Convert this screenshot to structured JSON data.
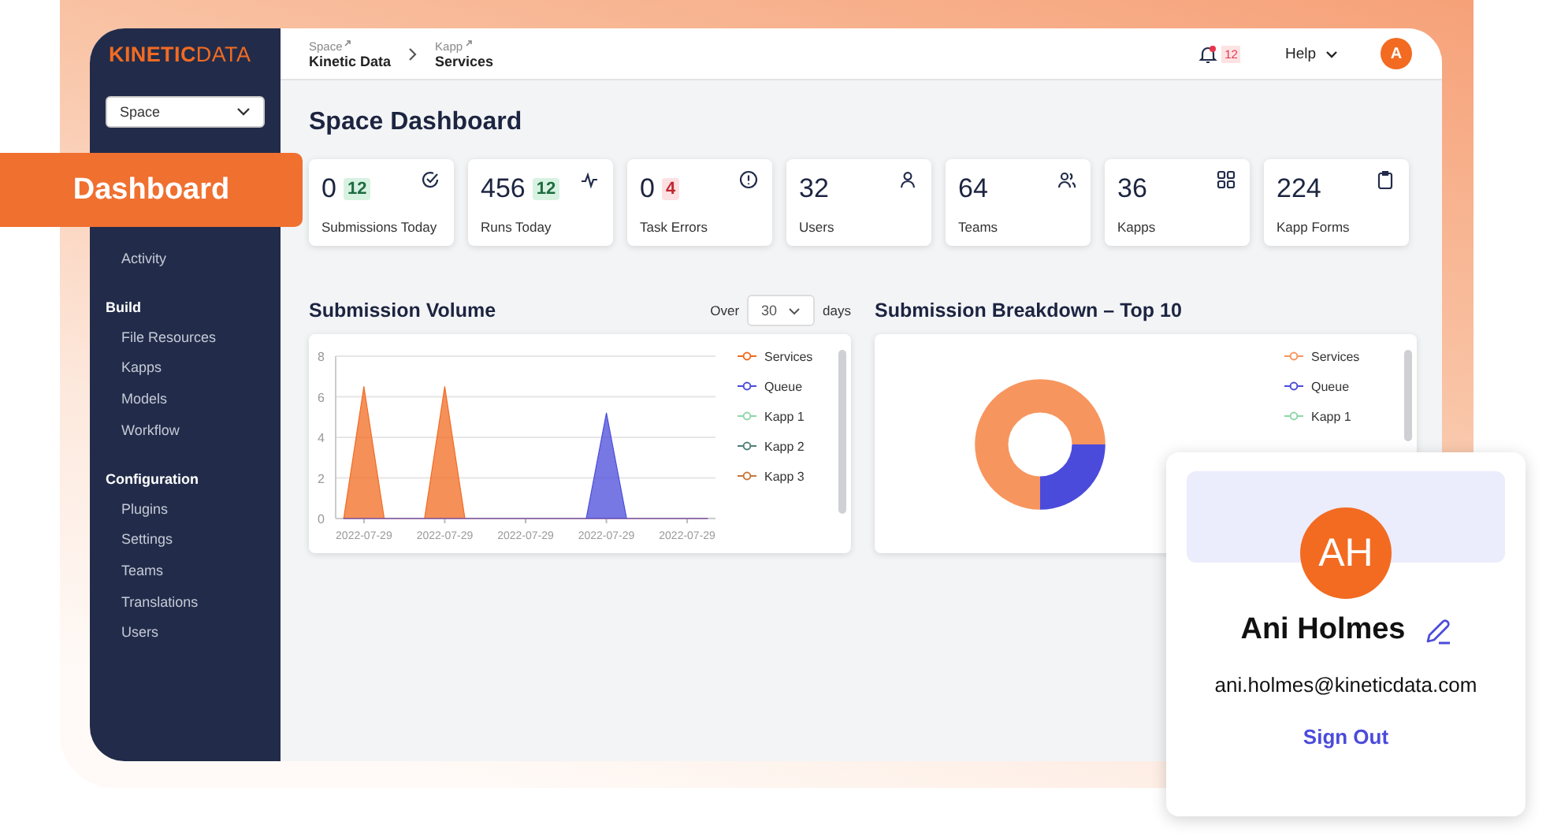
{
  "sidebar": {
    "logo": {
      "bold": "KINETIC",
      "light": "DATA"
    },
    "space_select": {
      "value": "Space"
    },
    "groups": [
      {
        "items": [
          "Activity"
        ]
      },
      {
        "heading": "Build",
        "items": [
          "File Resources",
          "Kapps",
          "Models",
          "Workflow"
        ]
      },
      {
        "heading": "Configuration",
        "items": [
          "Plugins",
          "Settings",
          "Teams",
          "Translations",
          "Users"
        ]
      }
    ]
  },
  "callout": {
    "label": "Dashboard"
  },
  "header": {
    "breadcrumbs": [
      {
        "label": "Space",
        "value": "Kinetic Data"
      },
      {
        "label": "Kapp",
        "value": "Services"
      }
    ],
    "notifications": "12",
    "help": "Help",
    "avatar": "A"
  },
  "page_title": "Space Dashboard",
  "stats": [
    {
      "value": "0",
      "badge": "12",
      "alert": false,
      "label": "Submissions Today"
    },
    {
      "value": "456",
      "badge": "12",
      "alert": false,
      "label": "Runs Today"
    },
    {
      "value": "0",
      "badge": "4",
      "alert": true,
      "label": "Task Errors"
    },
    {
      "value": "32",
      "label": "Users"
    },
    {
      "value": "64",
      "label": "Teams"
    },
    {
      "value": "36",
      "label": "Kapps"
    },
    {
      "value": "224",
      "label": "Kapp Forms"
    }
  ],
  "volume": {
    "title": "Submission Volume",
    "range": {
      "prefix": "Over",
      "value": "30",
      "suffix": "days"
    },
    "chart_data": {
      "type": "area",
      "grid": true,
      "legend": "right",
      "categories": [
        null,
        "2022-07-29",
        null,
        null,
        null,
        "2022-07-29",
        null,
        null,
        null,
        "2022-07-29",
        null,
        null,
        null,
        "2022-07-29",
        null,
        null,
        null,
        "2022-07-29",
        null
      ],
      "ylim": [
        0,
        8
      ],
      "yticks": [
        0,
        2,
        4,
        6,
        8
      ],
      "series": [
        {
          "name": "Services",
          "color": "#f26b21",
          "values": [
            0,
            6.5,
            0,
            0,
            0,
            6.5,
            0,
            0,
            0,
            0,
            0,
            0,
            0,
            0,
            0,
            0,
            0,
            0,
            0
          ]
        },
        {
          "name": "Queue",
          "color": "#4b4bdb",
          "values": [
            0,
            0,
            0,
            0,
            0,
            0,
            0,
            0,
            0,
            0,
            0,
            0,
            0,
            5.2,
            0,
            0,
            0,
            0,
            0
          ]
        },
        {
          "name": "Kapp 1",
          "color": "#8fd6a8",
          "values": [
            null,
            null,
            null,
            null,
            null,
            null,
            null,
            null,
            null,
            null,
            null,
            null,
            null,
            null,
            null,
            null,
            null,
            null,
            null
          ]
        },
        {
          "name": "Kapp 2",
          "color": "#4f7f77",
          "values": [
            null,
            null,
            null,
            null,
            null,
            null,
            null,
            null,
            null,
            null,
            null,
            null,
            null,
            null,
            null,
            null,
            null,
            null,
            null
          ]
        },
        {
          "name": "Kapp 3",
          "color": "#c8773a",
          "values": [
            null,
            null,
            null,
            null,
            null,
            null,
            null,
            null,
            null,
            null,
            null,
            null,
            null,
            null,
            null,
            null,
            null,
            null,
            null
          ]
        }
      ]
    }
  },
  "breakdown": {
    "title": "Submission Breakdown – Top 10",
    "legend": [
      {
        "label": "Services",
        "color": "#f7955e"
      },
      {
        "label": "Queue",
        "color": "#4b4bdb"
      },
      {
        "label": "Kapp 1",
        "color": "#8fd6a8"
      }
    ]
  },
  "profile": {
    "initials": "AH",
    "name": "Ani Holmes",
    "email": "ani.holmes@kineticdata.com",
    "sign_out": "Sign Out"
  }
}
